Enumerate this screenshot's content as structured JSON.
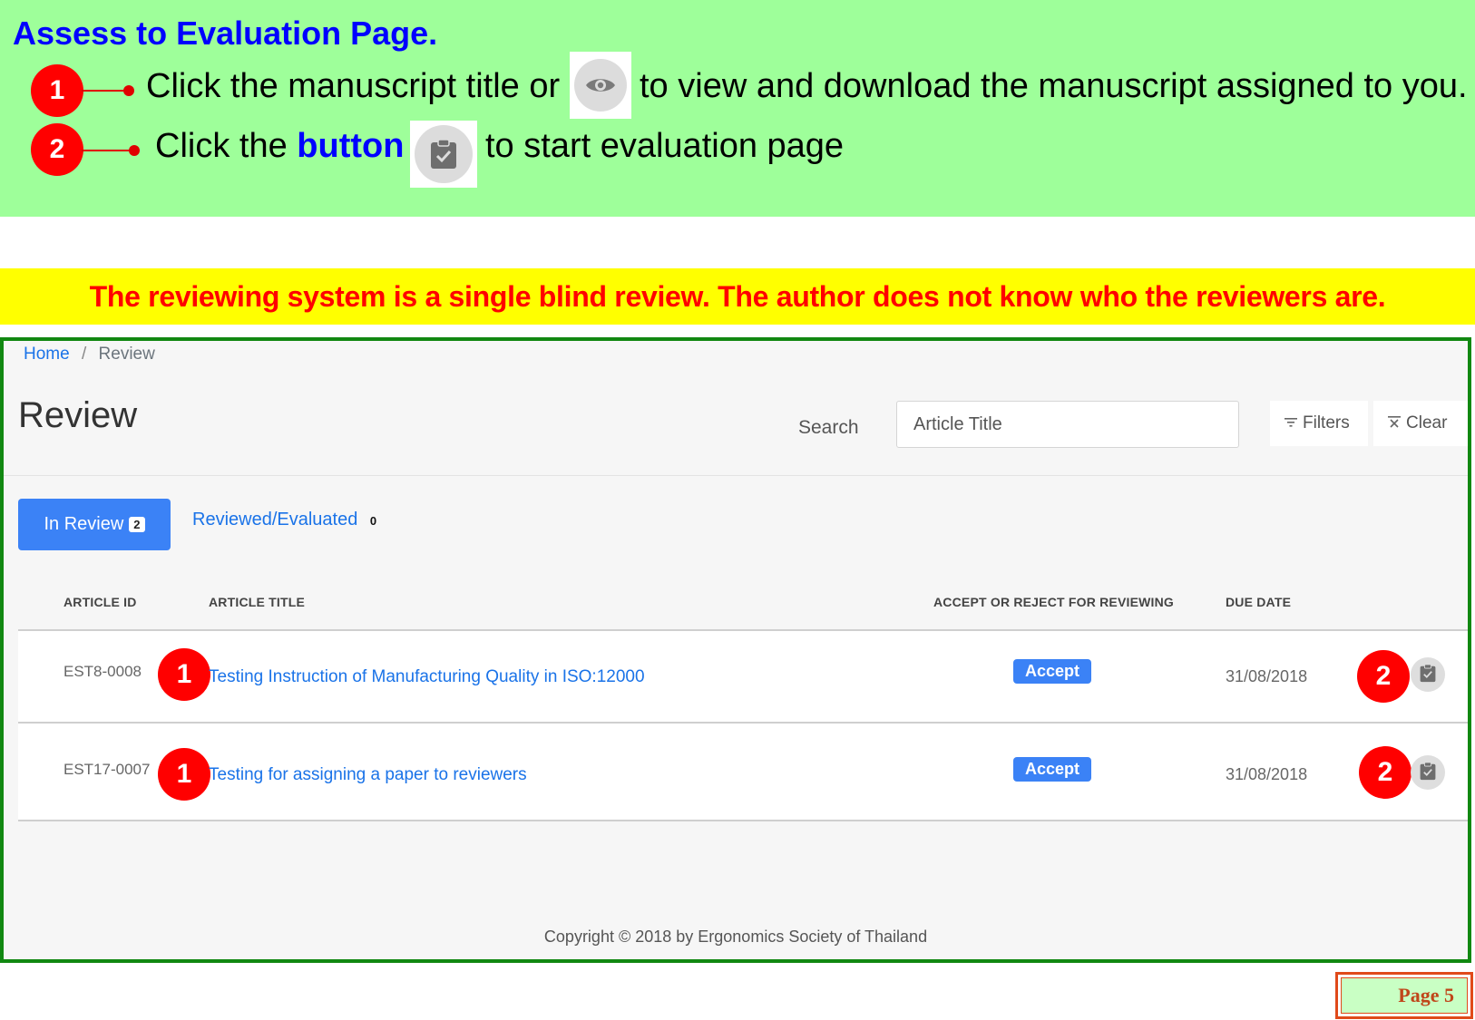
{
  "instructions": {
    "title": "Assess to Evaluation Page.",
    "step1": {
      "number": "1",
      "text_before": "Click the manuscript title or",
      "icon": "eye-icon",
      "text_after": "to view and download the manuscript assigned to you."
    },
    "step2": {
      "number": "2",
      "text_before": "Click the",
      "highlight": "button",
      "icon": "clipboard-check-icon",
      "text_after": "to start evaluation page"
    }
  },
  "banner": {
    "text": "The reviewing system is a single blind review. The author does not know who the reviewers are."
  },
  "app": {
    "breadcrumb": {
      "home": "Home",
      "separator": "/",
      "current": "Review"
    },
    "page_title": "Review",
    "search": {
      "label": "Search",
      "placeholder": "Article Title"
    },
    "buttons": {
      "filters": "Filters",
      "filters_icon": "filter-icon",
      "clear": "Clear",
      "clear_icon": "clear-filter-icon"
    },
    "tabs": [
      {
        "label": "In Review",
        "count": "2",
        "active": true
      },
      {
        "label": "Reviewed/Evaluated",
        "count": "0",
        "active": false
      }
    ],
    "table": {
      "headers": [
        "ARTICLE ID",
        "ARTICLE TITLE",
        "ACCEPT OR REJECT FOR REVIEWING",
        "DUE DATE"
      ],
      "rows": [
        {
          "id": "EST8-0008",
          "title": "Testing Instruction of Manufacturing Quality in ISO:12000",
          "status": "Accept",
          "due": "31/08/2018",
          "marker_title": "1",
          "marker_action": "2"
        },
        {
          "id": "EST17-0007",
          "title": "Testing for assigning a paper to reviewers",
          "status": "Accept",
          "due": "31/08/2018",
          "marker_title": "1",
          "marker_action": "2"
        }
      ]
    },
    "copyright": "Copyright © 2018 by Ergonomics Society of Thailand"
  },
  "page_badge": "Page 5",
  "colors": {
    "instruction_bg": "#9eff9a",
    "banner_bg": "#ffff00",
    "banner_text": "#ff0000",
    "accent_blue": "#3b82f6",
    "link_blue": "#1a73e8",
    "marker_red": "#ff0000",
    "frame_green": "#118811"
  }
}
